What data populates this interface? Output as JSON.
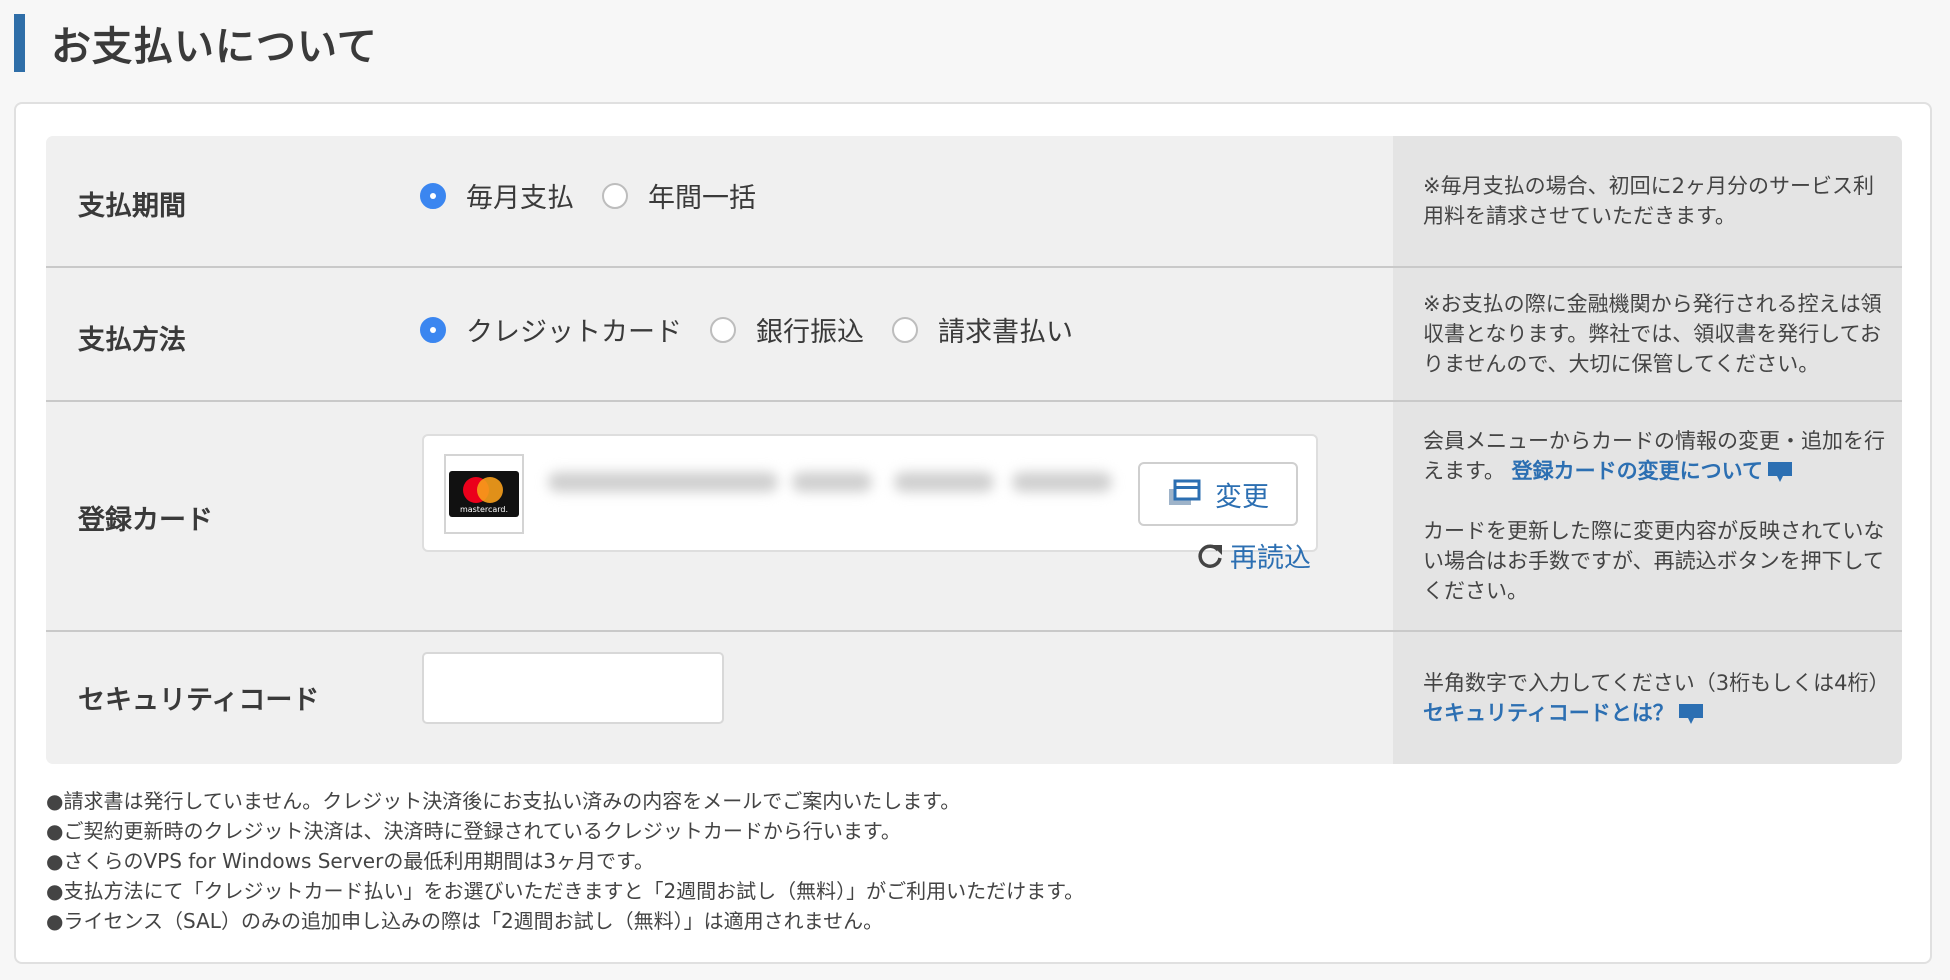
{
  "page": {
    "title": "お支払いについて"
  },
  "colors": {
    "accent": "#2f6ea8",
    "radio_checked": "#3b86f0",
    "link": "#2c6fb2"
  },
  "rows": {
    "period": {
      "label": "支払期間",
      "options": [
        {
          "label": "毎月支払",
          "checked": true
        },
        {
          "label": "年間一括",
          "checked": false
        }
      ],
      "note": "※毎月支払の場合、初回に2ヶ月分のサービス利用料を請求させていただきます。"
    },
    "method": {
      "label": "支払方法",
      "options": [
        {
          "label": "クレジットカード",
          "checked": true
        },
        {
          "label": "銀行振込",
          "checked": false
        },
        {
          "label": "請求書払い",
          "checked": false
        }
      ],
      "note": "※お支払の際に金融機関から発行される控えは領収書となります。弊社では、領収書を発行しておりませんので、大切に保管してください。"
    },
    "card": {
      "label": "登録カード",
      "card_brand_text": "mastercard.",
      "card_brand_icon": "mastercard-logo",
      "change_label": "変更",
      "change_icon": "card-change-icon",
      "reload_label": "再読込",
      "reload_icon": "reload-icon",
      "note_text1": "会員メニューからカードの情報の変更・追加を行えます。",
      "note_link": "登録カードの変更について",
      "note_text2": "カードを更新した際に変更内容が反映されていない場合はお手数ですが、再読込ボタンを押下してください。"
    },
    "security": {
      "label": "セキュリティコード",
      "input_value": "",
      "note_text": "半角数字で入力してください（3桁もしくは4桁）",
      "note_link": "セキュリティコードとは？"
    }
  },
  "notes": [
    "●請求書は発行していません。クレジット決済後にお支払い済みの内容をメールでご案内いたします。",
    "●ご契約更新時のクレジット決済は、決済時に登録されているクレジットカードから行います。",
    "●さくらのVPS for Windows Serverの最低利用期間は3ヶ月です。",
    "●支払方法にて「クレジットカード払い」をお選びいただきますと「2週間お試し（無料）」がご利用いただけます。",
    "●ライセンス（SAL）のみの追加申し込みの際は「2週間お試し（無料）」は適用されません。"
  ]
}
